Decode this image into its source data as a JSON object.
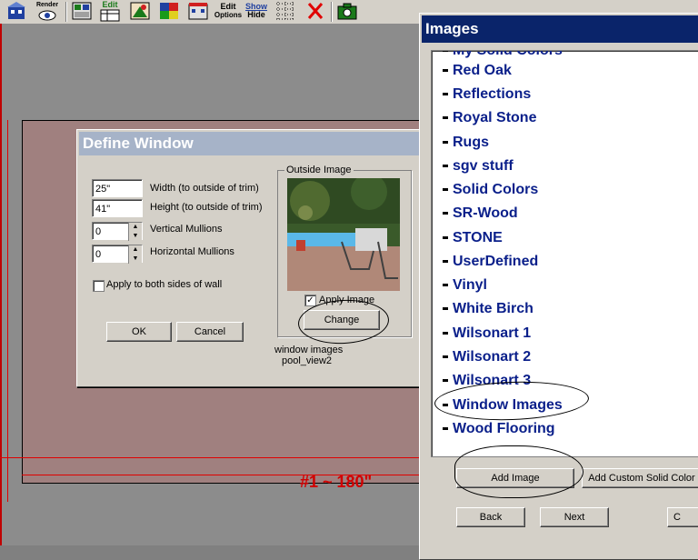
{
  "toolbar": {
    "render_label": "Render",
    "edit_label": "Edit",
    "edit_options_line1": "Edit",
    "edit_options_line2": "Options",
    "show_label": "Show",
    "hide_label": "Hide"
  },
  "canvas": {
    "dimension_label": "#1 ~ 180\""
  },
  "define_window": {
    "title": "Define Window",
    "width_value": "25\"",
    "width_label": "Width (to outside of trim)",
    "height_value": "41\"",
    "height_label": "Height (to outside of trim)",
    "vertical_mullions_value": "0",
    "vertical_mullions_label": "Vertical Mullions",
    "horizontal_mullions_value": "0",
    "horizontal_mullions_label": "Horizontal Mullions",
    "apply_both_sides_label": "Apply to both sides of wall",
    "ok_label": "OK",
    "cancel_label": "Cancel",
    "outside_image_label": "Outside Image",
    "apply_image_label": "Apply Image",
    "change_label": "Change",
    "image_folder": "window images",
    "image_name": "pool_view2"
  },
  "images_dialog": {
    "title": "Images",
    "partial_top_item": "My Solid Colors",
    "items": [
      {
        "label": "Red Oak"
      },
      {
        "label": "Reflections"
      },
      {
        "label": "Royal Stone"
      },
      {
        "label": "Rugs"
      },
      {
        "label": "sgv stuff"
      },
      {
        "label": "Solid Colors"
      },
      {
        "label": "SR-Wood"
      },
      {
        "label": "STONE"
      },
      {
        "label": "UserDefined"
      },
      {
        "label": "Vinyl"
      },
      {
        "label": "White Birch"
      },
      {
        "label": "Wilsonart 1"
      },
      {
        "label": "Wilsonart 2"
      },
      {
        "label": "Wilsonart 3"
      },
      {
        "label": "Window Images"
      },
      {
        "label": "Wood Flooring"
      }
    ],
    "add_image_label": "Add Image",
    "add_custom_solid_color_label": "Add Custom Solid Color",
    "back_label": "Back",
    "next_label": "Next",
    "cancel_partial_label": "C"
  }
}
